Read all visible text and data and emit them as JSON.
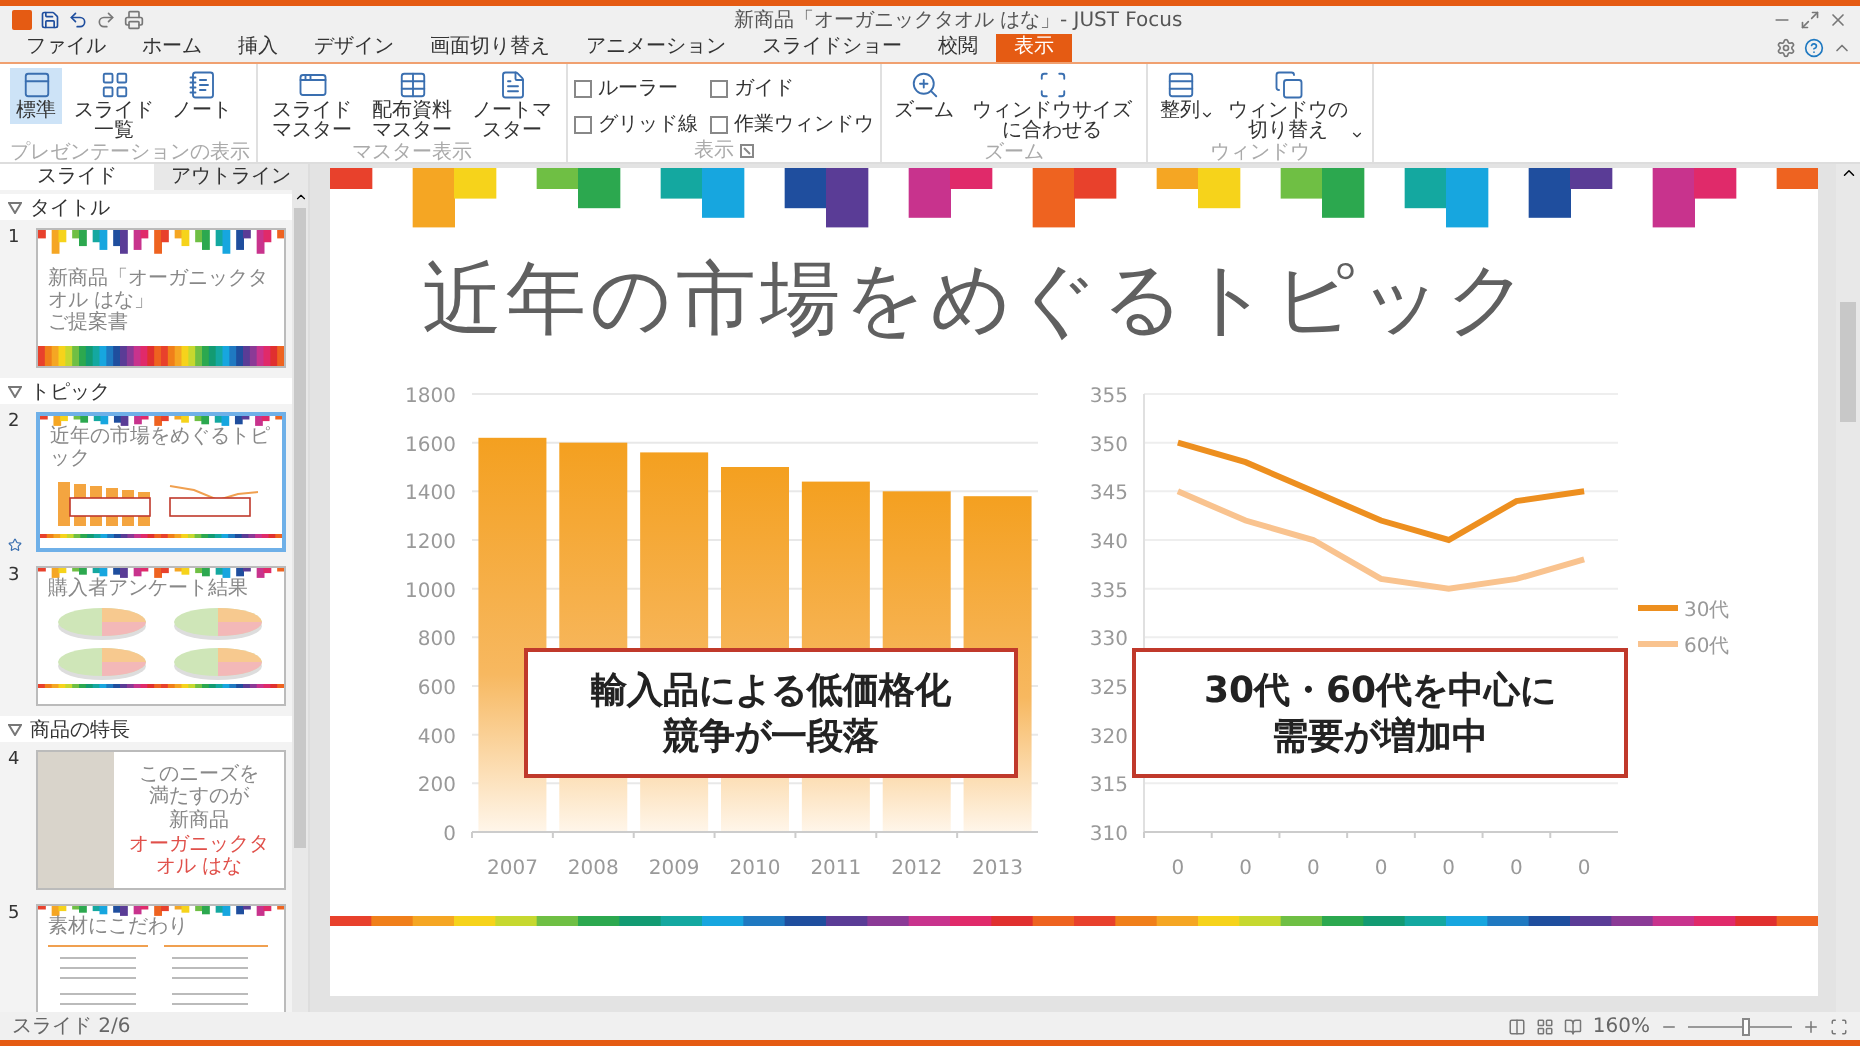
{
  "window": {
    "title": "新商品「オーガニックタオル はな」- JUST Focus"
  },
  "ribbon_tabs": [
    {
      "label": "ファイル",
      "selected": false
    },
    {
      "label": "ホーム",
      "selected": false
    },
    {
      "label": "挿入",
      "selected": false
    },
    {
      "label": "デザイン",
      "selected": false
    },
    {
      "label": "画面切り替え",
      "selected": false
    },
    {
      "label": "アニメーション",
      "selected": false
    },
    {
      "label": "スライドショー",
      "selected": false
    },
    {
      "label": "校閲",
      "selected": false
    },
    {
      "label": "表示",
      "selected": true
    }
  ],
  "ribbon_groups": [
    {
      "label": "プレゼンテーションの表示",
      "items": [
        {
          "kind": "big",
          "label": "標準",
          "selected": true
        },
        {
          "kind": "big",
          "label": "スライド一覧",
          "selected": false
        },
        {
          "kind": "big",
          "label": "ノート",
          "selected": false
        }
      ]
    },
    {
      "label": "マスター表示",
      "items": [
        {
          "kind": "big",
          "label": "スライドマスター"
        },
        {
          "kind": "big",
          "label": "配布資料マスター"
        },
        {
          "kind": "big",
          "label": "ノートマスター"
        }
      ]
    },
    {
      "label": "表示",
      "launcher": true,
      "items": [
        {
          "kind": "check",
          "label": "ルーラー",
          "checked": false
        },
        {
          "kind": "check",
          "label": "ガイド",
          "checked": false
        },
        {
          "kind": "check",
          "label": "グリッド線",
          "checked": false
        },
        {
          "kind": "check",
          "label": "作業ウィンドウ",
          "checked": false
        }
      ]
    },
    {
      "label": "ズーム",
      "items": [
        {
          "kind": "big",
          "label": "ズーム"
        },
        {
          "kind": "big",
          "label": "ウィンドウサイズに合わせる"
        }
      ]
    },
    {
      "label": "ウィンドウ",
      "items": [
        {
          "kind": "big",
          "label": "整列",
          "dropdown": true
        },
        {
          "kind": "big",
          "label": "ウィンドウの切り替え",
          "dropdown": true
        }
      ]
    }
  ],
  "panel_tabs": [
    {
      "label": "スライド",
      "selected": true
    },
    {
      "label": "アウトライン",
      "selected": false
    }
  ],
  "sections": [
    {
      "title": "タイトル",
      "expanded": true,
      "slides": [
        {
          "number": "1",
          "selected": false,
          "kind": "title",
          "texts": [
            "新商品「オーガニックタオル はな」",
            "ご提案書"
          ]
        }
      ]
    },
    {
      "title": "トピック",
      "expanded": true,
      "slides": [
        {
          "number": "2",
          "selected": true,
          "transition": true,
          "kind": "chart",
          "texts": [
            "近年の市場をめぐるトピック"
          ]
        },
        {
          "number": "3",
          "selected": false,
          "kind": "survey",
          "texts": [
            "購入者アンケート結果"
          ]
        }
      ]
    },
    {
      "title": "商品の特長",
      "expanded": true,
      "slides": [
        {
          "number": "4",
          "selected": false,
          "kind": "photo",
          "texts": [
            "このニーズを満たすのが",
            "新商品",
            "オーガニックタオル はな"
          ]
        },
        {
          "number": "5",
          "selected": false,
          "kind": "text",
          "texts": [
            "素材にこだわり"
          ]
        }
      ]
    }
  ],
  "slide": {
    "title": "近年の市場をめぐるトピック",
    "charts": [
      {
        "callout": "輸入品による低価格化競争が一段落",
        "chart_data": {
          "type": "bar",
          "grid": true,
          "categories": [
            "2007",
            "2008",
            "2009",
            "2010",
            "2011",
            "2012",
            "2013"
          ],
          "values": [
            1620,
            1600,
            1560,
            1500,
            1440,
            1400,
            1380
          ],
          "ylim": [
            0,
            1800
          ],
          "yticks": [
            0,
            200,
            400,
            600,
            800,
            1000,
            1200,
            1400,
            1600,
            1800
          ]
        }
      },
      {
        "callout": "30代・60代を中心に需要が増加中",
        "chart_data": {
          "type": "line",
          "grid": true,
          "legend": "right",
          "categories": [
            "0",
            "0",
            "0",
            "0",
            "0",
            "0",
            "0"
          ],
          "series": [
            {
              "name": "30代",
              "color": "#ed8f1f",
              "values": [
                350,
                348,
                345,
                342,
                340,
                344,
                345
              ]
            },
            {
              "name": "60代",
              "color": "#f9c38f",
              "values": [
                345,
                342,
                340,
                336,
                335,
                336,
                338
              ]
            }
          ],
          "ylim": [
            310,
            355
          ],
          "yticks": [
            310,
            315,
            320,
            325,
            330,
            335,
            340,
            345,
            350,
            355
          ]
        }
      }
    ]
  },
  "status_bar": {
    "slide_indicator": "スライド 2/6",
    "zoom": "160%",
    "zoom_slider": {
      "level": 0.55
    }
  }
}
